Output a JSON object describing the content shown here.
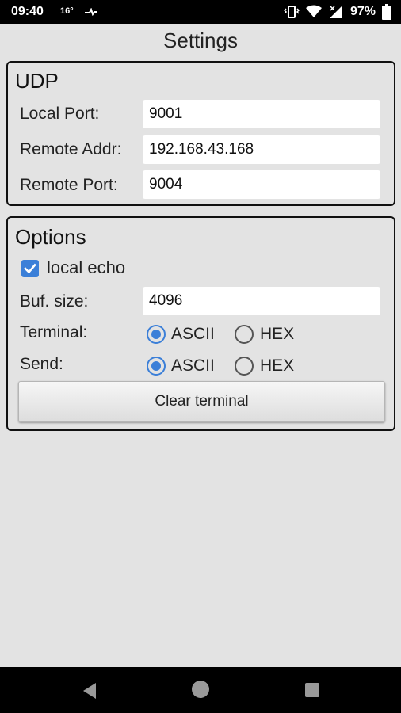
{
  "status_bar": {
    "time": "09:40",
    "temperature": "16°",
    "battery": "97%"
  },
  "screen": {
    "title": "Settings"
  },
  "udp": {
    "title": "UDP",
    "local_port_label": "Local Port:",
    "local_port_value": "9001",
    "remote_addr_label": "Remote Addr:",
    "remote_addr_value": "192.168.43.168",
    "remote_port_label": "Remote Port:",
    "remote_port_value": "9004"
  },
  "options": {
    "title": "Options",
    "local_echo_label": "local echo",
    "local_echo_checked": true,
    "buf_size_label": "Buf. size:",
    "buf_size_value": "4096",
    "terminal_label": "Terminal:",
    "terminal_selected": "ASCII",
    "send_label": "Send:",
    "send_selected": "ASCII",
    "mode_ascii": "ASCII",
    "mode_hex": "HEX",
    "clear_terminal_label": "Clear terminal"
  },
  "colors": {
    "accent": "#3b7fd8",
    "background": "#e3e3e3"
  },
  "icons": [
    "vibrate-icon",
    "wifi-icon",
    "cell-signal-icon",
    "battery-icon",
    "back-icon",
    "home-icon",
    "recents-icon",
    "checkmark-icon"
  ]
}
